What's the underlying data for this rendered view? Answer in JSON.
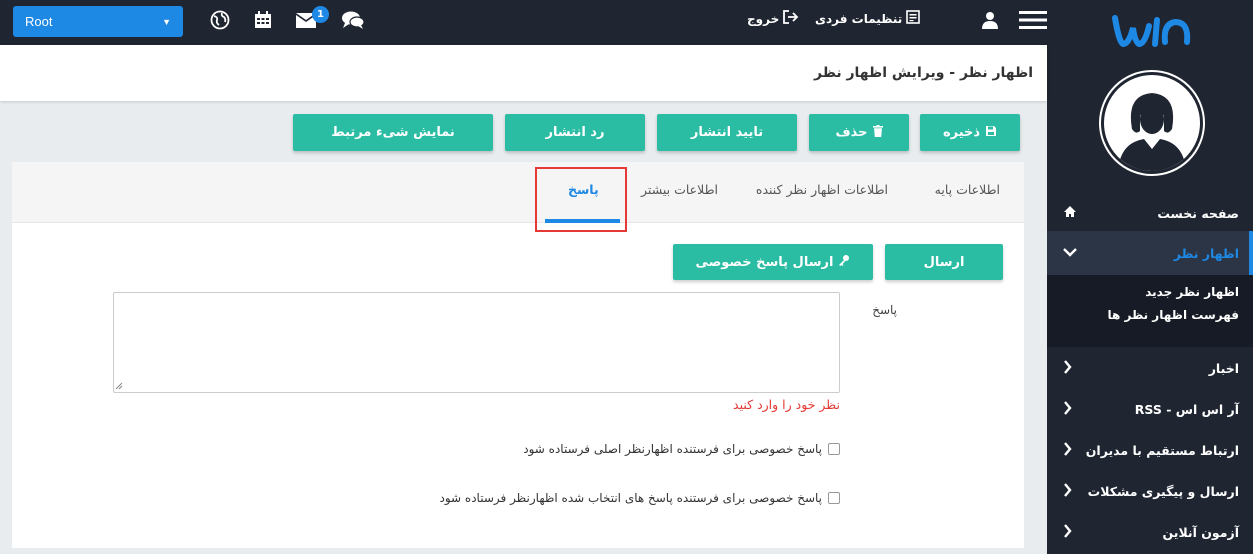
{
  "topbar": {
    "root_select": "Root",
    "notification_count": "1",
    "personal_settings": "تنظیمات فردی",
    "logout": "خروج"
  },
  "sidebar": {
    "items": [
      {
        "label": "صفحه نخست",
        "icon": "home-icon"
      },
      {
        "label": "اظهار نظر",
        "icon": "chevron-down-icon",
        "active": true
      },
      {
        "label": "اخبار",
        "icon": "chevron-left-icon"
      },
      {
        "label": "آر اس اس - RSS",
        "icon": "chevron-left-icon"
      },
      {
        "label": "ارتباط مستقیم با مدیران",
        "icon": "chevron-left-icon"
      },
      {
        "label": "ارسال و پیگیری مشکلات",
        "icon": "chevron-left-icon"
      },
      {
        "label": "آزمون آنلاین",
        "icon": "chevron-left-icon"
      }
    ],
    "submenu": [
      "اظهار نظر جدید",
      "فهرست اظهار نظر ها"
    ]
  },
  "page": {
    "title": "اظهار نظر - ویرایش اظهار نظر"
  },
  "actions": {
    "save": "ذخیره",
    "delete": "حذف",
    "approve": "تایید انتشار",
    "reject": "رد انتشار",
    "show_related": "نمایش شیء مرتبط"
  },
  "tabs": {
    "basic": "اطلاعات پایه",
    "commenter": "اطلاعات اظهار نظر کننده",
    "more": "اطلاعات بیشتر",
    "reply": "پاسخ"
  },
  "reply_form": {
    "send": "ارسال",
    "send_private": "ارسال پاسخ خصوصی",
    "reply_label": "پاسخ",
    "error": "نظر خود را وارد کنید",
    "check1": "پاسخ خصوصی برای فرستنده اظهارنظر اصلی فرستاده شود",
    "check2": "پاسخ خصوصی برای فرستنده پاسخ های انتخاب شده اظهارنظر فرستاده شود"
  },
  "colors": {
    "accent": "#1e88e5",
    "button": "#2bbca4",
    "dark": "#1f2531",
    "error": "#e53935"
  }
}
